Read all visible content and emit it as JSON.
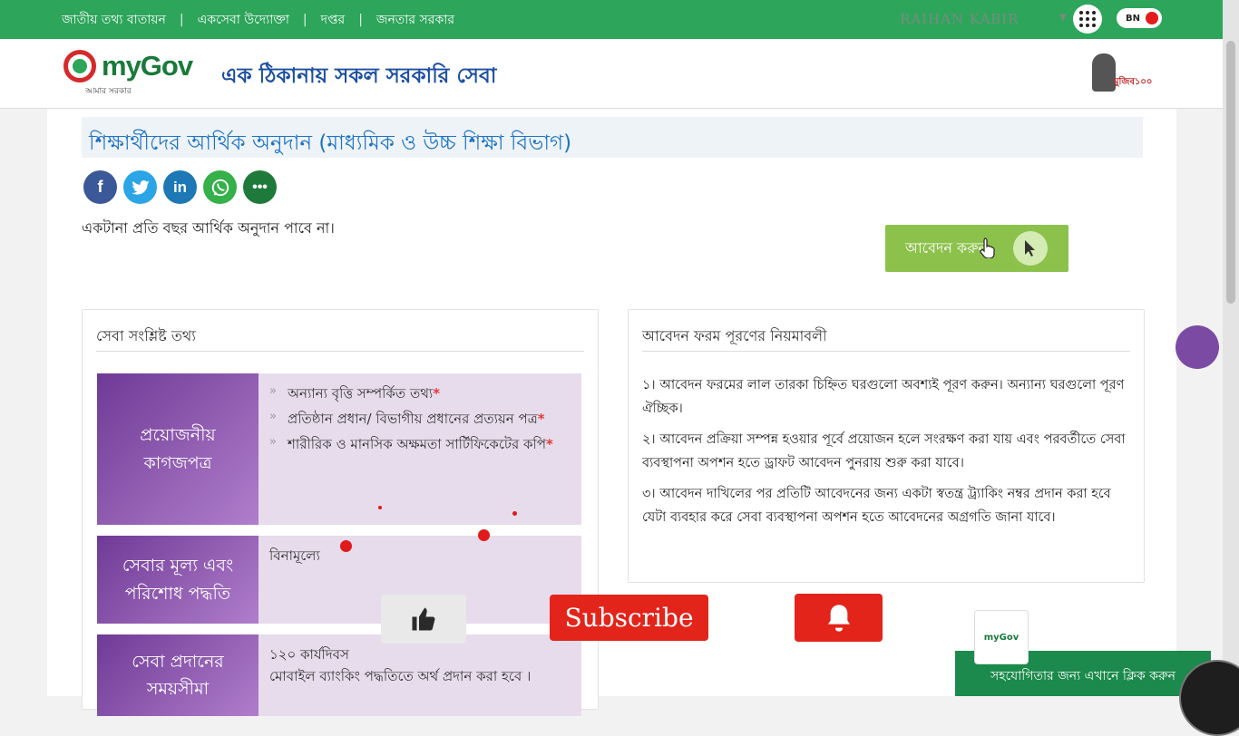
{
  "topbar": {
    "links": [
      "জাতীয় তথ্য বাতায়ন",
      "একসেবা উদ্যোক্তা",
      "দপ্তর",
      "জনতার সরকার"
    ],
    "separator": "|",
    "user_name": "RAIHAN KABIR",
    "lang_label": "BN"
  },
  "header": {
    "logo_text": "myGov",
    "logo_sub": "আমার সরকার",
    "tagline": "এক ঠিকানায় সকল সরকারি সেবা",
    "mujib_badge": "মুজিব১০০"
  },
  "page": {
    "title": "শিক্ষার্থীদের আর্থিক অনুদান (মাধ্যমিক ও উচ্চ শিক্ষা বিভাগ)",
    "note": "একটানা প্রতি বছর আর্থিক অনুদান পাবে না।",
    "apply_label": "আবেদন করুন",
    "share_icons": [
      "facebook-icon",
      "twitter-icon",
      "linkedin-icon",
      "whatsapp-icon",
      "more-icon"
    ]
  },
  "service_info": {
    "heading": "সেবা সংশ্লিষ্ট তথ্য",
    "rows": [
      {
        "label": "প্রয়োজনীয় কাগজপত্র",
        "docs": [
          "অন্যান্য বৃত্তি সম্পর্কিত তথ্য",
          "প্রতিষ্ঠান প্রধান/ বিভাগীয় প্রধানের প্রত্যয়ন পত্র",
          "শারীরিক ও মানসিক অক্ষমতা সার্টিফিকেটের কপি"
        ]
      },
      {
        "label": "সেবার মূল্য এবং পরিশোধ পদ্ধতি",
        "value": "বিনামূল্যে"
      },
      {
        "label": "সেবা প্রদানের সময়সীমা",
        "value_line1": "১২০ কার্যদিবস",
        "value_line2": "মোবাইল ব্যাংকিং পদ্ধতিতে অর্থ প্রদান করা হবে ।"
      }
    ]
  },
  "rules": {
    "heading": "আবেদন ফরম পূরণের নিয়মাবলী",
    "items": [
      "১। আবেদন ফরমের লাল তারকা চিহ্নিত ঘরগুলো অবশ্যই পূরণ করুন। অন্যান্য ঘরগুলো পূরণ ঐচ্ছিক।",
      "২। আবেদন প্রক্রিয়া সম্পন্ন হওয়ার পূর্বে প্রয়োজন হলে সংরক্ষণ করা যায় এবং পরবর্তীতে সেবা ব্যবস্থাপনা অপশন হতে ড্রাফট আবেদন পুনরায় শুরু করা যাবে।",
      "৩। আবেদন দাখিলের পর প্রতিটি আবেদনের জন্য একটা স্বতন্ত্র ট্র্যাকিং নম্বর প্রদান করা হবে যেটা ব্যবহার করে সেবা ব্যবস্থাপনা অপশন হতে আবেদনের অগ্রগতি জানা যাবে।"
    ]
  },
  "overlay": {
    "subscribe_label": "Subscribe",
    "help_label": "সহযোগিতার জন্য এখানে ক্লিক করুন",
    "help_logo": "myGov"
  },
  "colors": {
    "topbar": "#2da55b",
    "title_blue": "#1d73c4",
    "apply_green": "#8cc24b",
    "purple": "#7b4aa3",
    "subscribe_red": "#e3241b"
  }
}
